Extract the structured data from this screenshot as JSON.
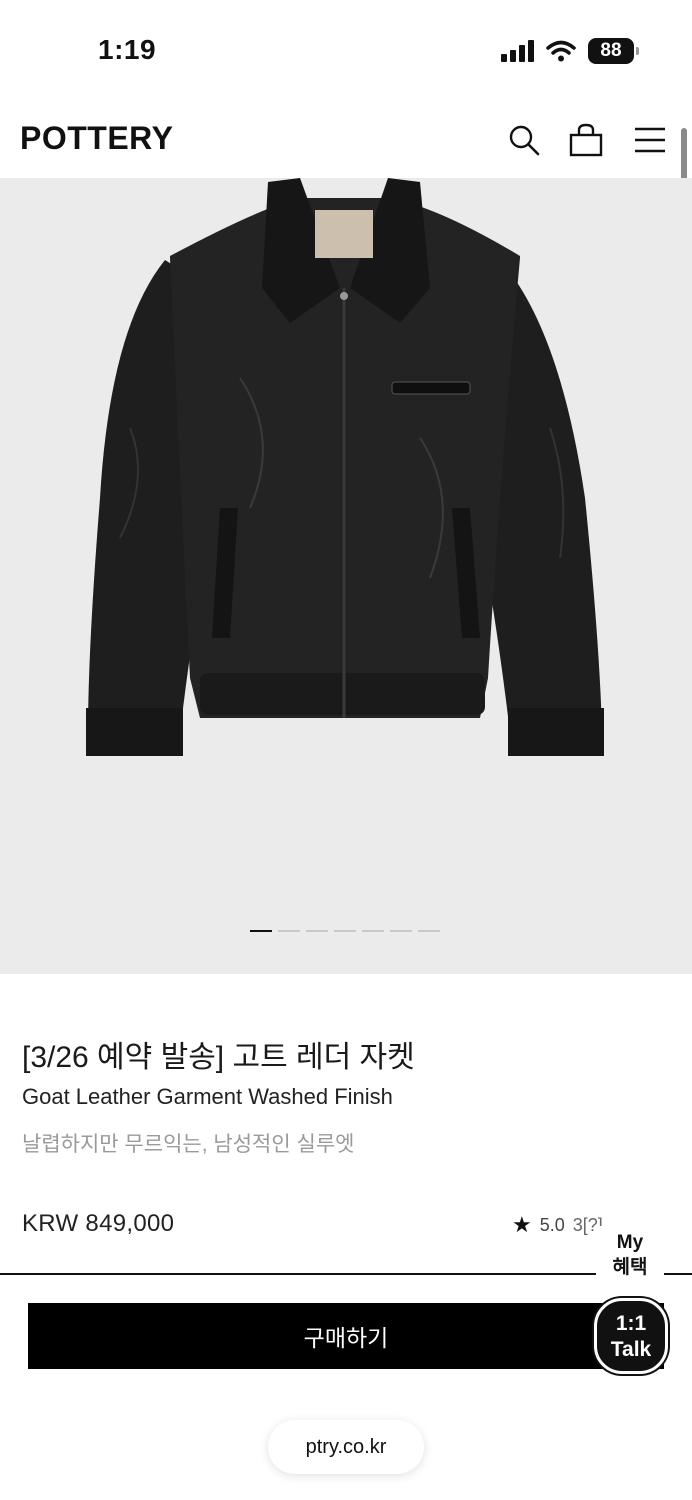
{
  "status_bar": {
    "time": "1:19",
    "battery": "88"
  },
  "header": {
    "logo": "POTTERY"
  },
  "gallery": {
    "dot_count": 7,
    "active_index": 0,
    "background": "#ebebeb"
  },
  "product": {
    "title": "[3/26 예약 발송] 고트 레더 자켓",
    "subtitle": "Goat Leather Garment Washed Finish",
    "tagline": "날렵하지만 무르익는, 남성적인 실루엣",
    "price": "KRW 849,000",
    "rating": "5.0",
    "reviews": "3[?]"
  },
  "my_benefit": {
    "line1": "My",
    "line2": "혜택"
  },
  "buy_button": {
    "label": "구매하기"
  },
  "talk_button": {
    "line1": "1:1",
    "line2": "Talk"
  },
  "browser": {
    "url": "ptry.co.kr"
  },
  "colors": {
    "accent": "#000000",
    "text": "#111111",
    "muted": "#9a9a9a"
  }
}
